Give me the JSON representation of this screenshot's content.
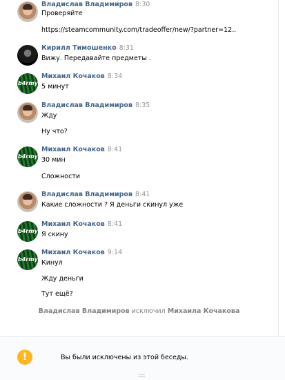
{
  "messages": [
    {
      "author": "Владислав Владимиров",
      "time": "8:30",
      "lines": [
        "Проверяйте",
        "https://steamcommunity.com/tradeoffer/new/?partner=12.."
      ]
    },
    {
      "author": "Кирилл Тимошенко",
      "time": "8:31",
      "lines": [
        "Вижу. Передавайте предметы ."
      ]
    },
    {
      "author": "Михаил Кочаков",
      "time": "8:34",
      "lines": [
        "5 минут"
      ]
    },
    {
      "author": "Владислав Владимиров",
      "time": "8:35",
      "lines": [
        "Жду",
        "Ну что?"
      ]
    },
    {
      "author": "Михаил Кочаков",
      "time": "8:41",
      "lines": [
        "30 мин",
        "Сложности"
      ]
    },
    {
      "author": "Владислав Владимиров",
      "time": "8:41",
      "lines": [
        "Какие сложности ? Я деньги скинул уже"
      ]
    },
    {
      "author": "Михаил Кочаков",
      "time": "8:41",
      "lines": [
        "Я скину"
      ]
    },
    {
      "author": "Михаил Кочаков",
      "time": "9:14",
      "lines": [
        "Кинул",
        "Жду деньги",
        "Тут ещё?"
      ]
    }
  ],
  "system": {
    "actor": "Владислав Владимиров",
    "action": "исключил",
    "target": "Михаила Кочакова"
  },
  "footer": {
    "icon": "warning-icon",
    "text": "Вы были исключены из этой беседы."
  }
}
